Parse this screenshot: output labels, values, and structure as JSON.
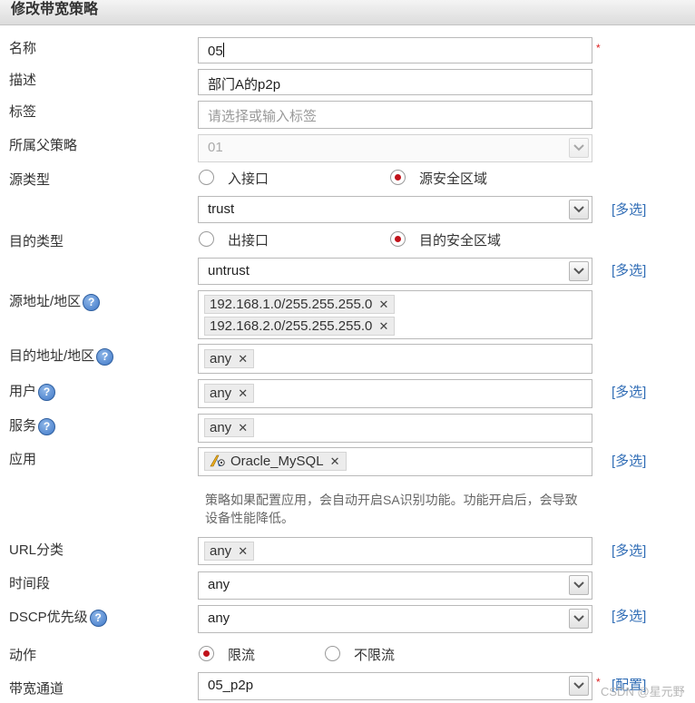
{
  "dialog": {
    "title": "修改带宽策略"
  },
  "labels": {
    "name": "名称",
    "description": "描述",
    "tag": "标签",
    "parent_policy": "所属父策略",
    "source_type": "源类型",
    "dest_type": "目的类型",
    "source_address": "源地址/地区",
    "dest_address": "目的地址/地区",
    "user": "用户",
    "service": "服务",
    "application": "应用",
    "url_category": "URL分类",
    "time_range": "时间段",
    "dscp": "DSCP优先级",
    "action": "动作",
    "bandwidth_channel": "带宽通道"
  },
  "fields": {
    "name_value": "05",
    "required_mark": "*",
    "description_value": "部门A的p2p",
    "tag_placeholder": "请选择或输入标签",
    "parent_policy_value": "01",
    "source_zone_value": "trust",
    "dest_zone_value": "untrust",
    "source_addresses": [
      "192.168.1.0/255.255.255.0",
      "192.168.2.0/255.255.255.0"
    ],
    "dest_address_tag": "any",
    "user_tag": "any",
    "service_tag": "any",
    "application_tag": "Oracle_MySQL",
    "app_note": "策略如果配置应用，会自动开启SA识别功能。功能开启后，会导致设备性能降低。",
    "url_tag": "any",
    "time_range_value": "any",
    "dscp_value": "any",
    "bandwidth_channel_value": "05_p2p"
  },
  "radios": {
    "source_interface": "入接口",
    "source_zone": "源安全区域",
    "source_selected": "源安全区域",
    "dest_interface": "出接口",
    "dest_zone": "目的安全区域",
    "dest_selected": "目的安全区域",
    "action_limit": "限流",
    "action_unlimited": "不限流",
    "action_selected": "限流"
  },
  "links": {
    "multi_select": "[多选]",
    "configure": "[配置]"
  },
  "tag_remove_glyph": "✕",
  "help_glyph": "?",
  "watermark": "CSDN @星元野",
  "colors": {
    "link": "#2f6cb5",
    "radio_selected": "#c0121a",
    "required": "#d22"
  }
}
